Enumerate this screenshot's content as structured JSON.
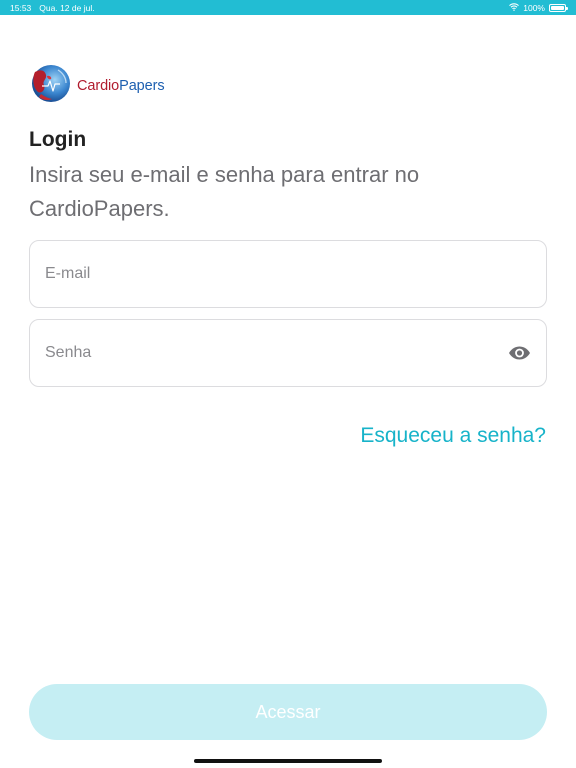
{
  "status_bar": {
    "time": "15:53",
    "date": "Qua. 12 de jul.",
    "battery": "100%",
    "battery_level": 1.0,
    "wifi_icon": "wifi-icon"
  },
  "logo": {
    "brand_part1": "Cardio",
    "brand_part2": "Papers",
    "icon": "cardiopapers-globe-logo"
  },
  "login": {
    "title": "Login",
    "subtitle": "Insira seu e-mail e senha para entrar no CardioPapers.",
    "email_placeholder": "E-mail",
    "password_placeholder": "Senha",
    "forgot_password": "Esqueceu a senha?",
    "submit_label": "Acessar"
  },
  "colors": {
    "accent": "#22bdd3",
    "link": "#17b3c9",
    "button_disabled": "#c5eef3",
    "brand_red": "#b01c2e",
    "brand_blue": "#1d5fb0"
  }
}
